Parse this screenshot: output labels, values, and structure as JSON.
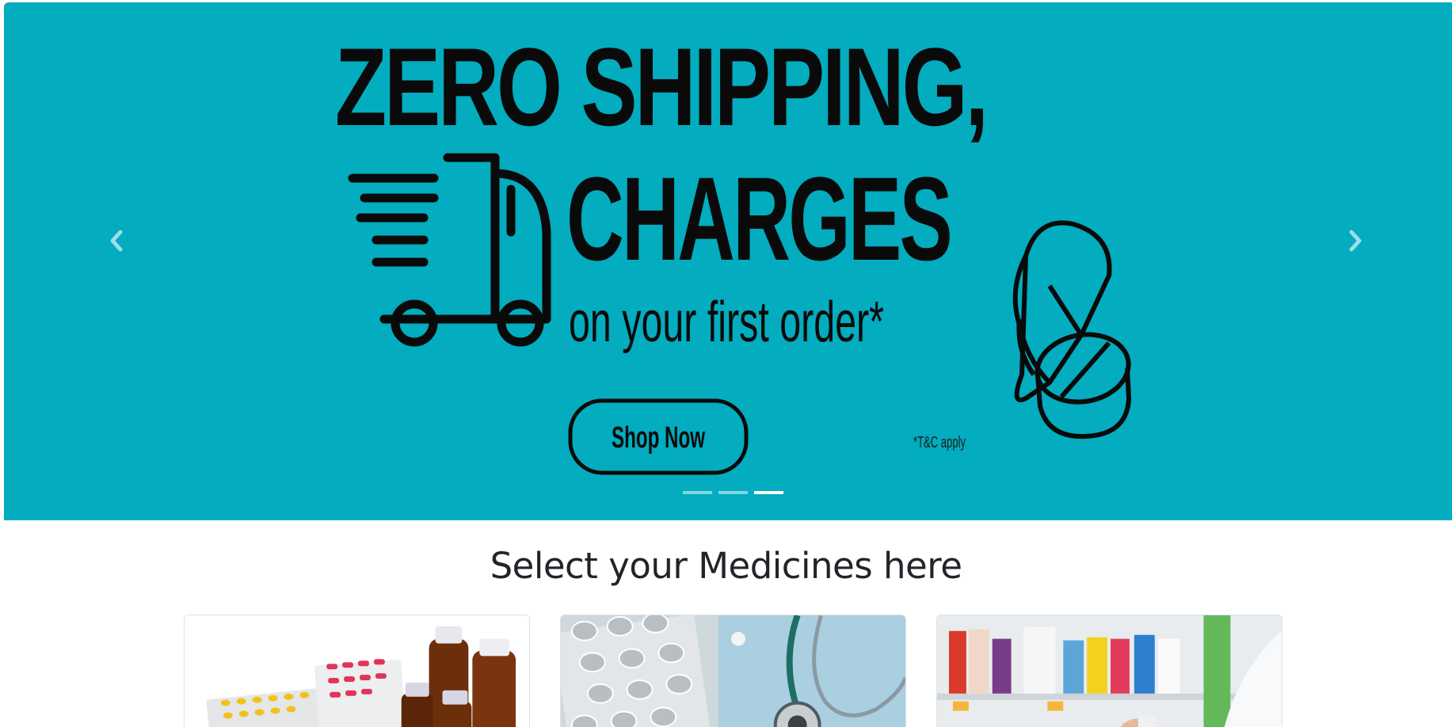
{
  "banner": {
    "line1": "ZERO SHIPPING,",
    "line2": "CHARGES",
    "line3": "on your first order*",
    "button_label": "Shop Now",
    "terms": "*T&C apply",
    "background_color": "#03acbe"
  },
  "carousel": {
    "prev_icon": "chevron-left-icon",
    "next_icon": "chevron-right-icon",
    "slide_count": 3,
    "active_slide": 3
  },
  "section": {
    "title": "Select your Medicines here"
  },
  "cards": [
    {
      "image": "medicine-bottles-and-blister-packs"
    },
    {
      "image": "blister-packs-and-stethoscope"
    },
    {
      "image": "pharmacy-shelves"
    }
  ]
}
